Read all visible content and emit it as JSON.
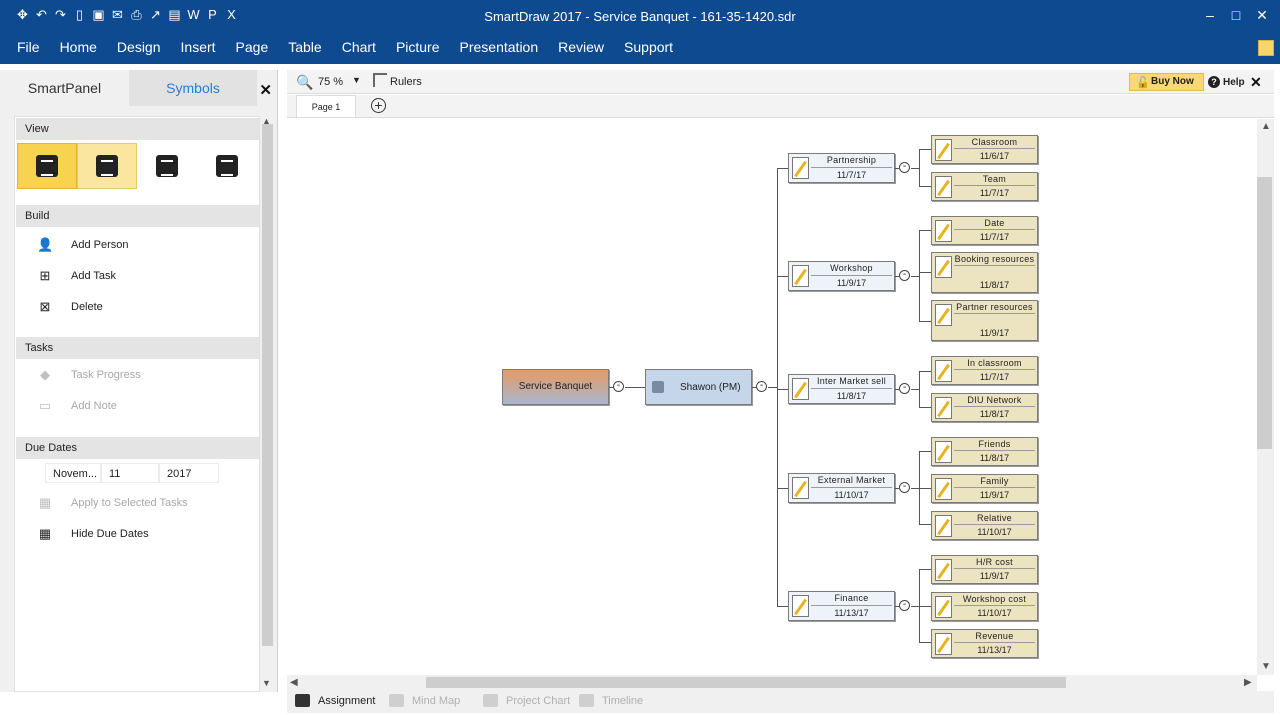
{
  "window": {
    "title": "SmartDraw 2017 - Service Banquet - 161-35-1420.sdr"
  },
  "menu": [
    "File",
    "Home",
    "Design",
    "Insert",
    "Page",
    "Table",
    "Chart",
    "Picture",
    "Presentation",
    "Review",
    "Support"
  ],
  "left_panel": {
    "tabs": [
      "SmartPanel",
      "Symbols"
    ],
    "view_label": "View",
    "build_label": "Build",
    "build_items": [
      "Add Person",
      "Add Task",
      "Delete"
    ],
    "tasks_label": "Tasks",
    "task_items": [
      "Task Progress",
      "Add Note"
    ],
    "due_dates_label": "Due Dates",
    "due_month": "Novem...",
    "due_day": "11",
    "due_year": "2017",
    "apply_label": "Apply to Selected Tasks",
    "hide_label": "Hide Due Dates"
  },
  "toolbar": {
    "zoom": "75 %",
    "rulers": "Rulers",
    "buy_now": "Buy Now",
    "help": "Help"
  },
  "page_tab": "Page 1",
  "bottom_tabs": [
    "Assignment",
    "Mind Map",
    "Project Chart",
    "Timeline"
  ],
  "diagram": {
    "root": "Service Banquet",
    "pm": "Shawon (PM)",
    "categories": [
      {
        "title": "Partnership",
        "date": "11/7/17",
        "tasks": [
          {
            "title": "Classroom",
            "date": "11/6/17"
          },
          {
            "title": "Team",
            "date": "11/7/17"
          }
        ]
      },
      {
        "title": "Workshop",
        "date": "11/9/17",
        "tasks": [
          {
            "title": "Date",
            "date": "11/7/17"
          },
          {
            "title": "Booking resources",
            "date": "11/8/17"
          },
          {
            "title": "Partner resources",
            "date": "11/9/17"
          }
        ]
      },
      {
        "title": "Inter Market sell",
        "date": "11/8/17",
        "tasks": [
          {
            "title": "In classroom",
            "date": "11/7/17"
          },
          {
            "title": "DIU Network",
            "date": "11/8/17"
          }
        ]
      },
      {
        "title": "External Market",
        "date": "11/10/17",
        "tasks": [
          {
            "title": "Friends",
            "date": "11/8/17"
          },
          {
            "title": "Family",
            "date": "11/9/17"
          },
          {
            "title": "Relative",
            "date": "11/10/17"
          }
        ]
      },
      {
        "title": "Finance",
        "date": "11/13/17",
        "tasks": [
          {
            "title": "H/R cost",
            "date": "11/9/17"
          },
          {
            "title": "Workshop cost",
            "date": "11/10/17"
          },
          {
            "title": "Revenue",
            "date": "11/13/17"
          }
        ]
      }
    ]
  }
}
